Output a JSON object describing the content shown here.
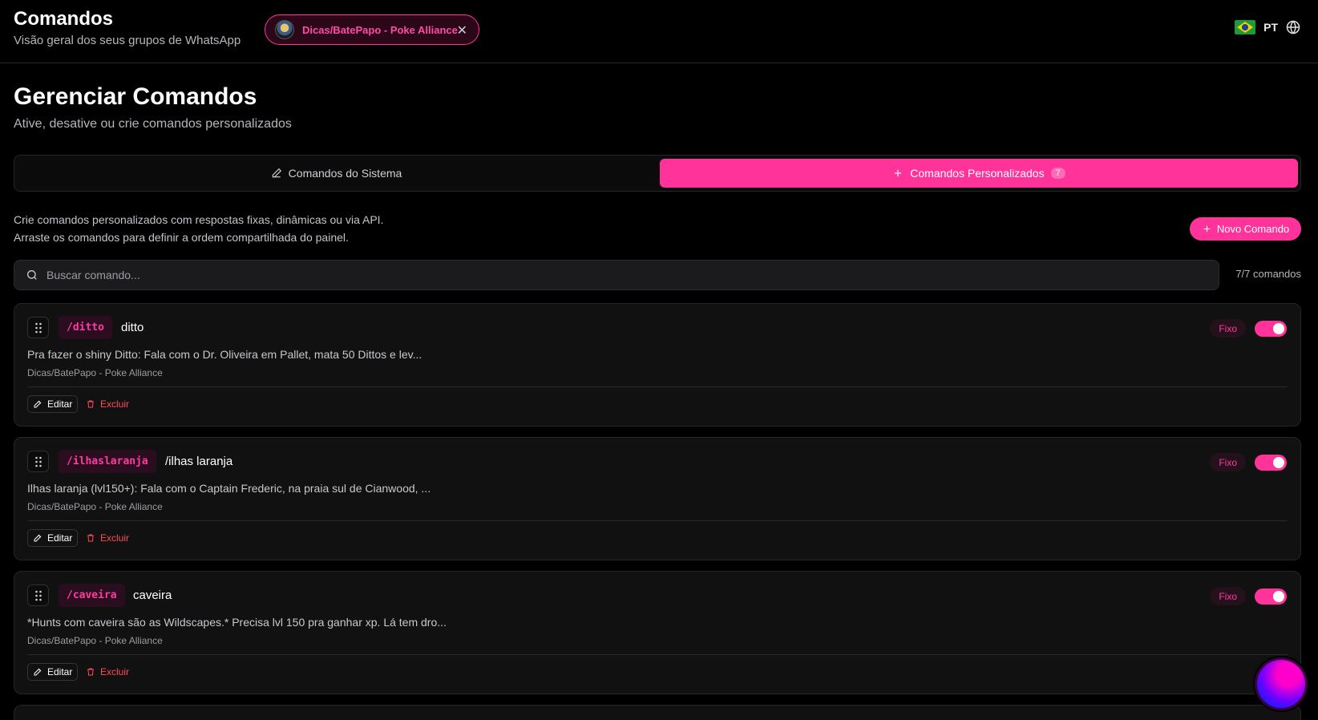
{
  "header": {
    "title": "Comandos",
    "subtitle": "Visão geral dos seus grupos de WhatsApp",
    "group_chip": "Dicas/BatePapo - Poke Alliance",
    "close_glyph": "✕",
    "lang_code": "PT",
    "flag_icon": "brazil-flag-icon",
    "globe_icon": "globe-icon"
  },
  "page": {
    "title": "Gerenciar Comandos",
    "subtitle": "Ative, desative ou crie comandos personalizados"
  },
  "tabs": {
    "system_label": "Comandos do Sistema",
    "custom_label": "Comandos Personalizados",
    "custom_count": "7",
    "active": "custom"
  },
  "intro": {
    "line1": "Crie comandos personalizados com respostas fixas, dinâmicas ou via API.",
    "line2": "Arraste os comandos para definir a ordem compartilhada do painel.",
    "new_button": "Novo Comando"
  },
  "search": {
    "placeholder": "Buscar comando...",
    "value": "",
    "count": "7/7 comandos"
  },
  "commands": [
    {
      "trigger": "/ditto",
      "name": "ditto",
      "preview": "Pra fazer o shiny Ditto: Fala com o Dr. Oliveira em Pallet, mata 50 Dittos e lev...",
      "group": "Dicas/BatePapo - Poke Alliance",
      "type": "Fixo",
      "enabled": true,
      "edit": "Editar",
      "delete": "Excluir"
    },
    {
      "trigger": "/ilhaslaranja",
      "name": "/ilhas laranja",
      "preview": "Ilhas laranja (lvl150+): Fala com o Captain Frederic, na praia sul de Cianwood, ...",
      "group": "Dicas/BatePapo - Poke Alliance",
      "type": "Fixo",
      "enabled": true,
      "edit": "Editar",
      "delete": "Excluir"
    },
    {
      "trigger": "/caveira",
      "name": "caveira",
      "preview": "*Hunts com caveira são as Wildscapes.* Precisa lvl 150 pra ganhar xp. Lá tem dro...",
      "group": "Dicas/BatePapo - Poke Alliance",
      "type": "Fixo",
      "enabled": true,
      "edit": "Editar",
      "delete": "Excluir"
    }
  ],
  "colors": {
    "accent": "#ff3399",
    "background": "#000000",
    "card": "#111112",
    "danger": "#ff4a5a"
  }
}
